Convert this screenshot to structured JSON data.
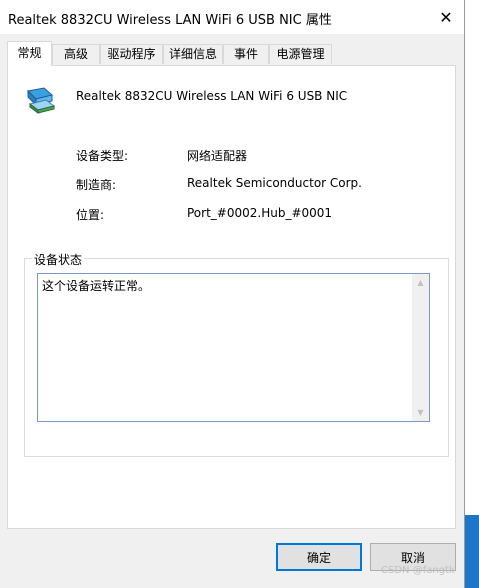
{
  "window": {
    "title": "Realtek 8832CU Wireless LAN WiFi 6 USB NIC 属性",
    "close_glyph": "✕"
  },
  "tabs": [
    {
      "label": "常规",
      "active": true
    },
    {
      "label": "高级"
    },
    {
      "label": "驱动程序"
    },
    {
      "label": "详细信息"
    },
    {
      "label": "事件"
    },
    {
      "label": "电源管理"
    }
  ],
  "general": {
    "device_icon": "network-adapter-icon",
    "device_name": "Realtek 8832CU Wireless LAN WiFi 6 USB NIC",
    "properties": [
      {
        "label": "设备类型:",
        "value": "网络适配器"
      },
      {
        "label": "制造商:",
        "value": "Realtek Semiconductor Corp."
      },
      {
        "label": "位置:",
        "value": "Port_#0002.Hub_#0001"
      }
    ],
    "status_group_title": "设备状态",
    "status_text": "这个设备运转正常。"
  },
  "buttons": {
    "ok": "确定",
    "cancel": "取消"
  },
  "watermark": "CSDN @fangtk",
  "colors": {
    "accent": "#0078d7",
    "dialog_bg": "#f0f0f0",
    "panel_bg": "#ffffff"
  }
}
